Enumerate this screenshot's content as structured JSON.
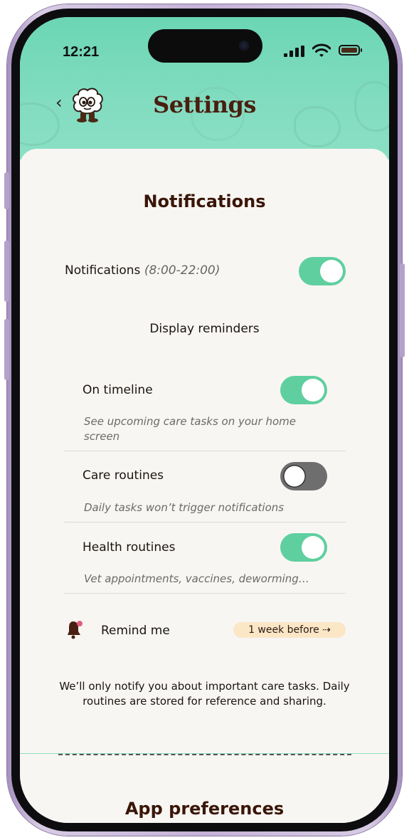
{
  "status_bar": {
    "time": "12:21"
  },
  "header": {
    "back_glyph": "‹",
    "title": "Settings",
    "mascot_icon": "pet-mascot-icon",
    "colors": {
      "header": "#6bd6b4",
      "title": "#4a1e0f"
    }
  },
  "notifications": {
    "heading": "Notifications",
    "master": {
      "label": "Notifications",
      "hours": "(8:00-22:00)",
      "enabled": true
    },
    "display_reminders_label": "Display reminders",
    "items": [
      {
        "label": "On timeline",
        "hint": "See upcoming care tasks on your home screen",
        "enabled": true
      },
      {
        "label": "Care routines",
        "hint": "Daily tasks won’t trigger notifications",
        "enabled": false
      },
      {
        "label": "Health routines",
        "hint": "Vet appointments, vaccines, deworming…",
        "enabled": true
      }
    ],
    "remind_me": {
      "label": "Remind me",
      "value": "1 week before ⇢",
      "icon": "bell-icon"
    },
    "info_text": "We’ll only notify you about important care tasks. Daily routines are stored for reference and sharing."
  },
  "app_preferences": {
    "heading": "App preferences"
  },
  "colors": {
    "toggle_on": "#5fcf9f",
    "toggle_off": "#6e6e6e",
    "pill": "#fbe6c6",
    "background": "#f8f6f3"
  }
}
